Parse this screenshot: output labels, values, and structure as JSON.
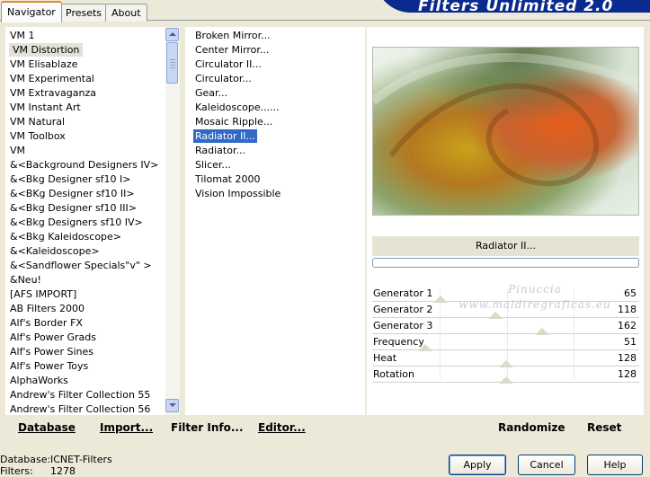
{
  "tabs": [
    {
      "label": "Navigator",
      "active": true
    },
    {
      "label": "Presets",
      "active": false
    },
    {
      "label": "About",
      "active": false
    }
  ],
  "banner_title": "Filters Unlimited 2.0",
  "categories": [
    "VM 1",
    "VM Distortion",
    "VM Elisablaze",
    "VM Experimental",
    "VM Extravaganza",
    "VM Instant Art",
    "VM Natural",
    "VM Toolbox",
    "VM",
    "&<Background Designers IV>",
    "&<Bkg Designer sf10 I>",
    "&<BKg Designer sf10 II>",
    "&<Bkg Designer sf10 III>",
    "&<Bkg Designers sf10 IV>",
    "&<Bkg Kaleidoscope>",
    "&<Kaleidoscope>",
    "&<Sandflower Specials\"v\" >",
    "&Neu!",
    "[AFS IMPORT]",
    "AB Filters 2000",
    "Alf's Border FX",
    "Alf's Power Grads",
    "Alf's Power Sines",
    "Alf's Power Toys",
    "AlphaWorks",
    "Andrew's Filter Collection 55",
    "Andrew's Filter Collection 56"
  ],
  "selected_category": "VM Distortion",
  "filters": [
    "Broken Mirror...",
    "Center Mirror...",
    "Circulator II...",
    "Circulator...",
    "Gear...",
    "Kaleidoscope......",
    "Mosaic Ripple...",
    "Radiator II...",
    "Radiator...",
    "Slicer...",
    "Tilomat 2000",
    "Vision Impossible"
  ],
  "selected_filter": "Radiator II...",
  "preview_filter_name": "Radiator II...",
  "watermark": [
    "Pinuccia",
    "www.maldiregraficas.eu"
  ],
  "params": [
    {
      "label": "Generator 1",
      "value": 65
    },
    {
      "label": "Generator 2",
      "value": 118
    },
    {
      "label": "Generator 3",
      "value": 162
    },
    {
      "label": "Frequency",
      "value": 51
    },
    {
      "label": "Heat",
      "value": 128
    },
    {
      "label": "Rotation",
      "value": 128
    }
  ],
  "toolbar": {
    "database": "Database",
    "import": "Import...",
    "filter_info": "Filter Info...",
    "editor": "Editor...",
    "randomize": "Randomize",
    "reset": "Reset"
  },
  "status": {
    "database_label": "Database:",
    "database_value": "ICNET-Filters",
    "filters_label": "Filters:",
    "filters_value": "1278"
  },
  "buttons": {
    "apply": "Apply",
    "cancel": "Cancel",
    "help": "Help"
  },
  "icons": [
    "scroll-up-icon",
    "scroll-down-icon",
    "scroll-thumb-grip-icon"
  ]
}
